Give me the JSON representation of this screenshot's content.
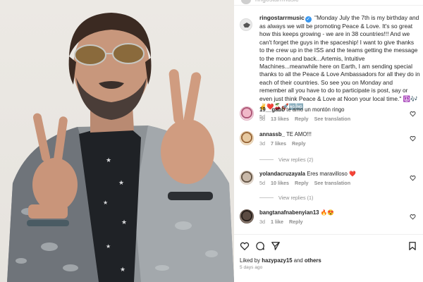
{
  "header": {
    "username": "ringostarrmusic"
  },
  "post": {
    "username": "ringostarrmusic",
    "caption": "\"Monday July the 7th is my birthday and as always we will be promoting Peace & Love. It's so great how this keeps growing - we are in 38 countries!!! And we can't forget the guys in the spaceship! I want to give thanks to the crew up in the ISS and the teams getting the message to the moon and back...Artemis, Intuitive Machines...meanwhile here on Earth, I am sending special thanks to all the Peace & Love Ambassadors for all they do in each of their countries. So see you on Monday and remember all you have to do to participate is post, say or even just think Peace & Love at Noon your local time.\" ☮️🎶✌️❤️🍒🚀🆖🆖",
    "age": "5d"
  },
  "comments": [
    {
      "username": "19__gabb",
      "text": "te amo un montón ringo",
      "age": "5d",
      "likes": "13 likes",
      "reply": "Reply",
      "translation": "See translation",
      "replies_label": ""
    },
    {
      "username": "annassb_",
      "text": "TE AMO!!!",
      "age": "3d",
      "likes": "7 likes",
      "reply": "Reply",
      "translation": "",
      "replies_label": "View replies (2)"
    },
    {
      "username": "yolandacruzayala",
      "text": "Eres maravilloso ❤️",
      "age": "5d",
      "likes": "10 likes",
      "reply": "Reply",
      "translation": "See translation",
      "replies_label": "View replies (1)"
    },
    {
      "username": "bangtanafnabenyian13",
      "text": "🔥😍",
      "age": "3d",
      "likes": "1 like",
      "reply": "Reply",
      "translation": "",
      "replies_label": ""
    }
  ],
  "footer": {
    "liked_prefix": "Liked by",
    "liked_user": "hazypazy15",
    "liked_and": "and",
    "liked_others": "others",
    "time_ago": "5 days ago"
  },
  "icons": {
    "actions": [
      "heart-icon",
      "comment-icon",
      "share-icon",
      "bookmark-icon"
    ],
    "comment_like": "heart-icon"
  },
  "colors": {
    "verified": "#3897f0",
    "muted": "#8e8e8e",
    "text": "#262626"
  }
}
